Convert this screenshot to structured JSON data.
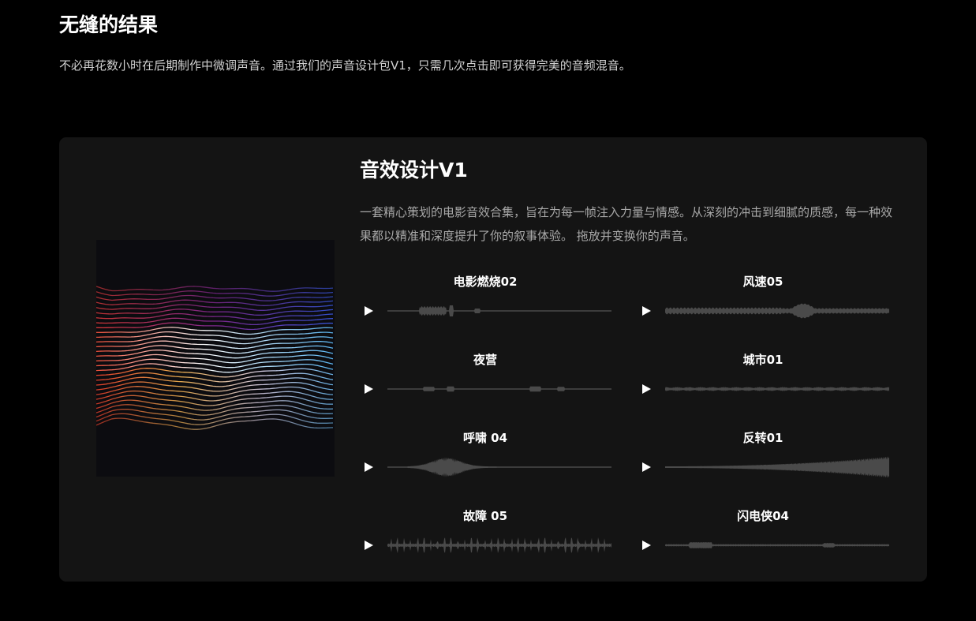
{
  "section": {
    "title": "无缝的结果",
    "description": "不必再花数小时在后期制作中微调声音。通过我们的声音设计包V1，只需几次点击即可获得完美的音频混音。"
  },
  "product": {
    "title": "音效设计V1",
    "description": "一套精心策划的电影音效合集，旨在为每一帧注入力量与情感。从深刻的冲击到细腻的质感，每一种效果都以精准和深度提升了你的叙事体验。 拖放并变换你的声音。",
    "cover_icon": "waveform-art-icon"
  },
  "tracks": [
    {
      "name": "电影燃烧02",
      "icon": "play-icon"
    },
    {
      "name": "风速05",
      "icon": "play-icon"
    },
    {
      "name": "夜营",
      "icon": "play-icon"
    },
    {
      "name": "城市01",
      "icon": "play-icon"
    },
    {
      "name": "呼啸 04",
      "icon": "play-icon"
    },
    {
      "name": "反转01",
      "icon": "play-icon"
    },
    {
      "name": "故障 05",
      "icon": "play-icon"
    },
    {
      "name": "闪电侠04",
      "icon": "play-icon"
    }
  ],
  "colors": {
    "background": "#000000",
    "card": "#141414",
    "waveform": "#4a4a4a",
    "text": "#ffffff",
    "muted_text": "#a8a8a8"
  }
}
